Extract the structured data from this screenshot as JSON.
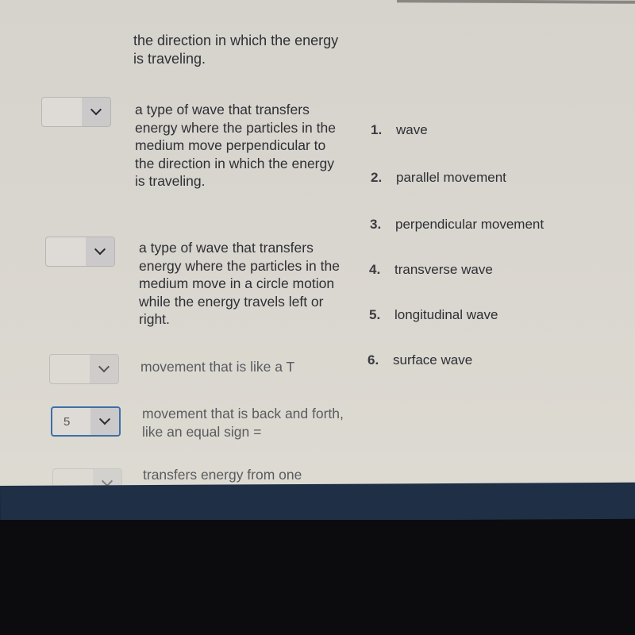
{
  "question": {
    "prev_fragment": "the direction in which the energy is traveling.",
    "rows": [
      {
        "selected": "",
        "text": "a type of wave that transfers energy where the particles in the medium move perpendicular to the direction in which the energy is traveling."
      },
      {
        "selected": "",
        "text": "a type of wave that transfers energy where the particles in the medium move in a circle motion while the energy travels left or right."
      },
      {
        "selected": "",
        "text": "movement that is like a T"
      },
      {
        "selected": "5",
        "text": "movement that is back and forth, like an equal sign  ="
      },
      {
        "selected": "",
        "text": "transfers energy from one"
      }
    ],
    "options": [
      {
        "num": "1.",
        "label": "wave"
      },
      {
        "num": "2.",
        "label": "parallel movement"
      },
      {
        "num": "3.",
        "label": "perpendicular movement"
      },
      {
        "num": "4.",
        "label": "transverse wave"
      },
      {
        "num": "5.",
        "label": "longitudinal wave"
      },
      {
        "num": "6.",
        "label": "surface wave"
      }
    ]
  }
}
